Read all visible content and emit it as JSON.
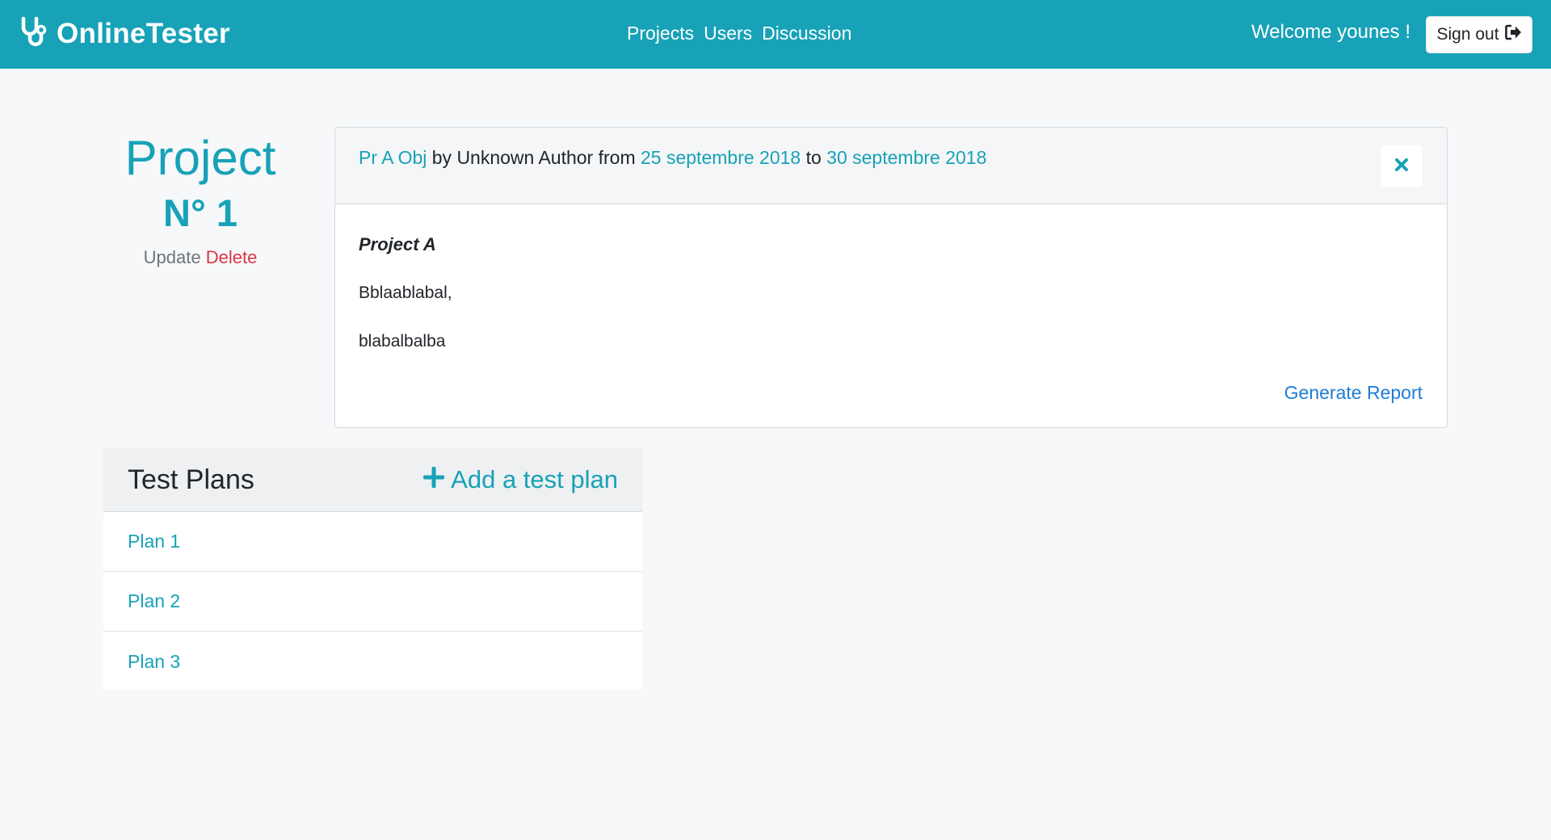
{
  "navbar": {
    "brand": "OnlineTester",
    "brand_icon": "stethoscope-icon",
    "links": [
      "Projects",
      "Users",
      "Discussion"
    ],
    "welcome": "Welcome younes !",
    "signout_label": "Sign out",
    "signout_icon": "sign-out-icon",
    "color": "#17a2b8"
  },
  "project": {
    "title": "Project",
    "number": "N° 1",
    "update_label": "Update",
    "delete_label": "Delete"
  },
  "card": {
    "objective": "Pr A Obj",
    "by_text": "by Unknown Author from",
    "start_date": "25 septembre 2018",
    "to_text": "to",
    "end_date": "30 septembre 2018",
    "close_icon": "close-icon",
    "description_title": "Project A",
    "description_lines": [
      "Bblaablabal,",
      "blabalbalba"
    ],
    "generate_report": "Generate Report"
  },
  "plans": {
    "title": "Test Plans",
    "add_label": "Add a test plan",
    "add_icon": "plus-icon",
    "items": [
      "Plan 1",
      "Plan 2",
      "Plan 3"
    ]
  }
}
